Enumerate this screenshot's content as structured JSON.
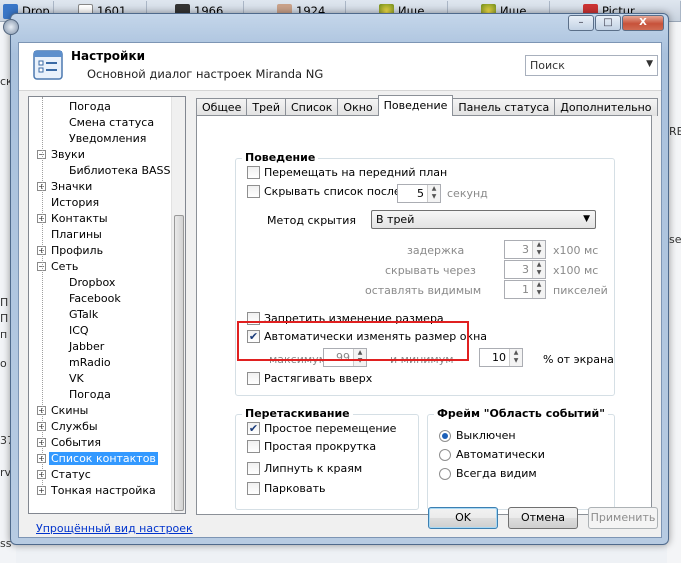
{
  "taskbar": {
    "items": [
      "Drop…",
      "1601…",
      "1966…",
      "1924…",
      "Ище…",
      "Ище…",
      "Pictur…"
    ]
  },
  "background_fragments": [
    "ск",
    "П",
    "П",
    "п",
    "о",
    "37",
    "rv",
    "ss",
    "RE",
    "se"
  ],
  "window": {
    "title": "Настройки",
    "subtitle": "Основной диалог настроек Miranda NG",
    "search_placeholder": "Поиск",
    "controls": {
      "minimize": "–",
      "maximize": "□",
      "close": "X"
    }
  },
  "tree": {
    "items": [
      {
        "label": "Погода",
        "level": 2,
        "expander": ""
      },
      {
        "label": "Смена статуса",
        "level": 2,
        "expander": ""
      },
      {
        "label": "Уведомления",
        "level": 2,
        "expander": ""
      },
      {
        "label": "Звуки",
        "level": 1,
        "expander": "−"
      },
      {
        "label": "Библиотека BASS",
        "level": 2,
        "expander": ""
      },
      {
        "label": "Значки",
        "level": 1,
        "expander": "+"
      },
      {
        "label": "История",
        "level": 1,
        "expander": ""
      },
      {
        "label": "Контакты",
        "level": 1,
        "expander": "+"
      },
      {
        "label": "Плагины",
        "level": 1,
        "expander": ""
      },
      {
        "label": "Профиль",
        "level": 1,
        "expander": "+"
      },
      {
        "label": "Сеть",
        "level": 1,
        "expander": "−"
      },
      {
        "label": "Dropbox",
        "level": 2,
        "expander": ""
      },
      {
        "label": "Facebook",
        "level": 2,
        "expander": ""
      },
      {
        "label": "GTalk",
        "level": 2,
        "expander": ""
      },
      {
        "label": "ICQ",
        "level": 2,
        "expander": ""
      },
      {
        "label": "Jabber",
        "level": 2,
        "expander": ""
      },
      {
        "label": "mRadio",
        "level": 2,
        "expander": ""
      },
      {
        "label": "VK",
        "level": 2,
        "expander": ""
      },
      {
        "label": "Погода",
        "level": 2,
        "expander": ""
      },
      {
        "label": "Скины",
        "level": 1,
        "expander": "+"
      },
      {
        "label": "Службы",
        "level": 1,
        "expander": "+"
      },
      {
        "label": "События",
        "level": 1,
        "expander": "+"
      },
      {
        "label": "Список контактов",
        "level": 1,
        "expander": "+",
        "selected": true
      },
      {
        "label": "Статус",
        "level": 1,
        "expander": "+"
      },
      {
        "label": "Тонкая настройка",
        "level": 1,
        "expander": "+"
      }
    ],
    "simple_view_link": "Упрощённый вид настроек"
  },
  "tabs": [
    {
      "label": "Общее"
    },
    {
      "label": "Трей"
    },
    {
      "label": "Список"
    },
    {
      "label": "Окно"
    },
    {
      "label": "Поведение",
      "active": true
    },
    {
      "label": "Панель статуса"
    },
    {
      "label": "Дополнительно"
    }
  ],
  "behavior": {
    "title": "Поведение",
    "bring_to_front": {
      "label": "Перемещать на передний план",
      "checked": false
    },
    "hide_after": {
      "label": "Скрывать список после",
      "checked": false,
      "value": "5",
      "unit": "секунд"
    },
    "hide_method_label": "Метод скрытия",
    "hide_method_value": "В трей",
    "delay": {
      "label": "задержка",
      "value": "3",
      "unit": "x100 мс"
    },
    "hide_through": {
      "label": "скрывать через",
      "value": "3",
      "unit": "x100 мс"
    },
    "leave_visible": {
      "label": "оставлять видимым",
      "value": "1",
      "unit": "пикселей"
    },
    "forbid_resize": {
      "label": "Запретить изменение размера",
      "checked": false
    },
    "auto_resize": {
      "label": "Автоматически изменять размер окна",
      "checked": true
    },
    "max": {
      "label": "максимум",
      "value": "99"
    },
    "min": {
      "label": "и минимум",
      "value": "10"
    },
    "percent_label": "% от экрана",
    "stretch_up": {
      "label": "Растягивать вверх",
      "checked": false
    }
  },
  "dragging": {
    "title": "Перетаскивание",
    "simple_move": {
      "label": "Простое перемещение",
      "checked": true
    },
    "simple_scroll": {
      "label": "Простая прокрутка",
      "checked": false
    },
    "stick_edges": {
      "label": "Липнуть к краям",
      "checked": false
    },
    "float": {
      "label": "Парковать",
      "checked": false
    }
  },
  "event_frame": {
    "title": "Фрейм \"Область событий\"",
    "options": [
      {
        "label": "Выключен",
        "selected": true
      },
      {
        "label": "Автоматически",
        "selected": false
      },
      {
        "label": "Всегда видим",
        "selected": false
      }
    ]
  },
  "buttons": {
    "ok": "OK",
    "cancel": "Отмена",
    "apply": "Применить"
  },
  "colors": {
    "accent": "#3399ff",
    "highlight_frame": "#e02020",
    "link": "#0033cc"
  }
}
